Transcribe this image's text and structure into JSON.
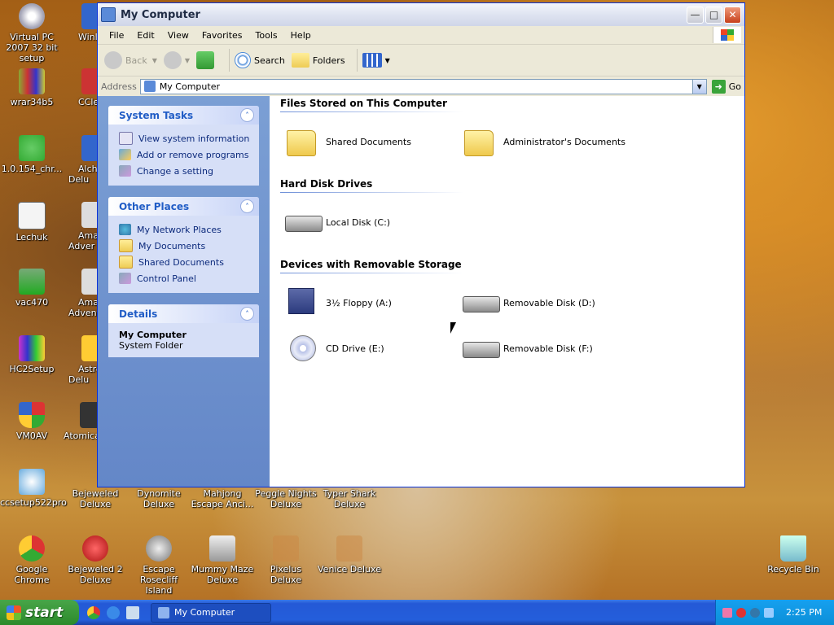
{
  "desktop": {
    "icons": [
      {
        "label": "Virtual PC 2007 32 bit setup"
      },
      {
        "label": "wrar34b5"
      },
      {
        "label": "1.0.154_chr..."
      },
      {
        "label": "Lechuk"
      },
      {
        "label": "vac470"
      },
      {
        "label": "HC2Setup"
      },
      {
        "label": "VM0AV"
      },
      {
        "label": "ccsetup522pro"
      },
      {
        "label": "Google Chrome"
      },
      {
        "label": "Winl"
      },
      {
        "label": "CCle"
      },
      {
        "label": "Alch Delu"
      },
      {
        "label": "Ama Adver"
      },
      {
        "label": "Ama Advent"
      },
      {
        "label": "Astro Delu"
      },
      {
        "label": "Atomica"
      },
      {
        "label": "Bejeweled Deluxe"
      },
      {
        "label": "Dynomite Deluxe"
      },
      {
        "label": "Mahjong Escape Anci..."
      },
      {
        "label": "Peggle Nights Deluxe"
      },
      {
        "label": "Typer Shark Deluxe"
      },
      {
        "label": "Bejeweled 2 Deluxe"
      },
      {
        "label": "Escape Rosecliff Island"
      },
      {
        "label": "Mummy Maze Deluxe"
      },
      {
        "label": "Pixelus Deluxe"
      },
      {
        "label": "Venice Deluxe"
      },
      {
        "label": "Recycle Bin"
      }
    ]
  },
  "window": {
    "title": "My Computer",
    "menu": [
      "File",
      "Edit",
      "View",
      "Favorites",
      "Tools",
      "Help"
    ],
    "toolbar": {
      "back": "Back",
      "search": "Search",
      "folders": "Folders"
    },
    "address": {
      "label": "Address",
      "value": "My Computer",
      "go": "Go"
    }
  },
  "taskpane": {
    "system_tasks": {
      "title": "System Tasks",
      "items": [
        "View system information",
        "Add or remove programs",
        "Change a setting"
      ]
    },
    "other_places": {
      "title": "Other Places",
      "items": [
        "My Network Places",
        "My Documents",
        "Shared Documents",
        "Control Panel"
      ]
    },
    "details": {
      "title": "Details",
      "name": "My Computer",
      "type": "System Folder"
    }
  },
  "main": {
    "groups": [
      {
        "title": "Files Stored on This Computer",
        "items": [
          "Shared Documents",
          "Administrator's Documents"
        ]
      },
      {
        "title": "Hard Disk Drives",
        "items": [
          "Local Disk (C:)"
        ]
      },
      {
        "title": "Devices with Removable Storage",
        "items": [
          "3½ Floppy (A:)",
          "Removable Disk (D:)",
          "CD Drive (E:)",
          "Removable Disk (F:)"
        ]
      }
    ]
  },
  "taskbar": {
    "start": "start",
    "task": "My Computer",
    "clock": "2:25 PM"
  }
}
